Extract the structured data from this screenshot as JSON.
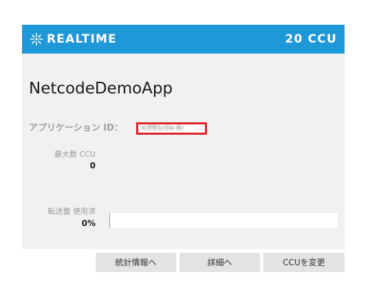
{
  "header": {
    "icon": "realtime-burst-icon",
    "title": "REALTIME",
    "ccu_plan": "20 CCU",
    "color": "#1e98d8"
  },
  "app": {
    "name": "NetcodeDemoApp",
    "id_label": "アプリケーション ID：",
    "id_value_masked": "e3f81c0a-8c",
    "id_ellipsis": "...",
    "highlight_color": "#e0202a"
  },
  "metrics": {
    "max_ccu": {
      "label": "最大数 CCU",
      "value": "0"
    },
    "traffic_used": {
      "label": "転送量 使用済",
      "value": "0%",
      "fraction": 0
    }
  },
  "actions": {
    "stats_label": "統計情報へ",
    "details_label": "詳細へ",
    "change_ccu_label": "CCUを変更"
  }
}
